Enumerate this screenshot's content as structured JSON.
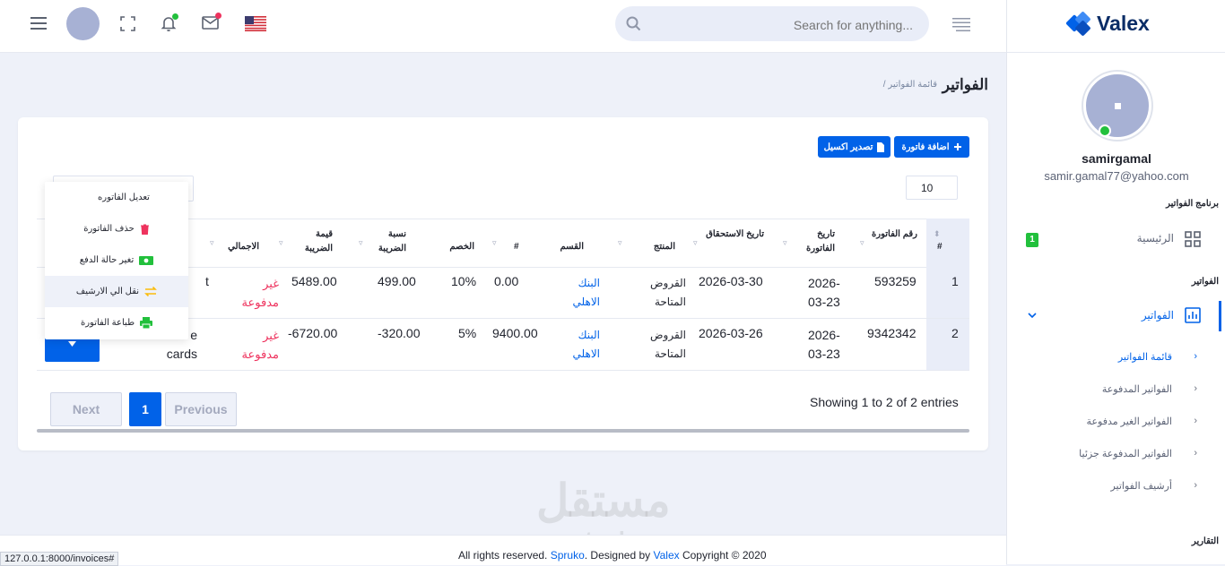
{
  "topbar": {
    "search_placeholder": "Search for anything..."
  },
  "brand": {
    "name": "Valex"
  },
  "breadcrumb": {
    "page_title": "الفواتير",
    "current": "/ قائمة الفواتير"
  },
  "profile": {
    "name": "samirgamal",
    "email": "samir.gamal77@yahoo.com"
  },
  "sidebar": {
    "section_program": "برنامج الفواتير",
    "home_label": "الرئيسية",
    "home_badge": "1",
    "section_invoices": "الفواتير",
    "invoices_label": "الفواتير",
    "sub_items": [
      "قائمة الفواتير",
      "الفواتير المدفوعة",
      "الفواتير الغير مدفوعة",
      "الفواتير المدفوعة جزئيا",
      "أرشيف الفواتير"
    ],
    "section_reports": "التقارير"
  },
  "actions": {
    "add_invoice": "اضافة فاتورة",
    "export_excel": "تصدير اكسيل",
    "page_length": "10"
  },
  "table": {
    "headers": {
      "index": "#",
      "invoice_number": "رقم الفاتورة",
      "invoice_date": "تاريخ الفاتورة",
      "due_date": "تاريخ الاستحقاق",
      "product": "المنتج",
      "section": "القسم",
      "discount_amount": "#",
      "discount": "الخصم",
      "vat_rate": "نسبة الضريبة",
      "vat_value": "قيمة الضريبة",
      "total": "الاجمالي"
    },
    "rows": [
      {
        "index": "1",
        "invoice_number": "593259",
        "invoice_date": "2026-03-23",
        "due_date": "2026-03-30",
        "product": "القروض المتاحة",
        "section": "البنك الاهلي",
        "amount": "0.00",
        "discount": "10%",
        "vat_rate": "499.00",
        "vat_value": "5489.00",
        "status": "غير مدفوعة",
        "note": "t"
      },
      {
        "index": "2",
        "invoice_number": "9342342",
        "invoice_date": "2026-03-23",
        "due_date": "2026-03-26",
        "product": "القروض المتاحة",
        "section": "البنك الاهلي",
        "amount": "9400.00",
        "discount": "5%",
        "vat_rate": "-320.00",
        "vat_value": "-6720.00",
        "status": "غير مدفوعة",
        "note": "e cards"
      }
    ]
  },
  "dropdown_menu": {
    "edit": "تعديل الفاتوره",
    "delete": "حذف الفاتورة",
    "change_status": "تغير حالة الدفع",
    "archive": "نقل الي الارشيف",
    "print": "طباعة الفاتورة"
  },
  "pagination": {
    "info": "Showing 1 to 2 of 2 entries",
    "previous": "Previous",
    "current_page": "1",
    "next": "Next"
  },
  "footer": {
    "copyright_prefix": "Copyright © 2020",
    "brand": "Valex",
    "designed_by": ". Designed by",
    "designer": "Spruko",
    "rights": "All rights reserved."
  },
  "status_url": "127.0.0.1:8000/invoices#",
  "watermark": {
    "arabic": "مستقل",
    "latin": "mostaql.com"
  },
  "colors": {
    "primary": "#0162e8",
    "danger": "#ee335e",
    "success": "#22c03c",
    "warning": "#fbbc0b",
    "link": "#0162e8"
  }
}
